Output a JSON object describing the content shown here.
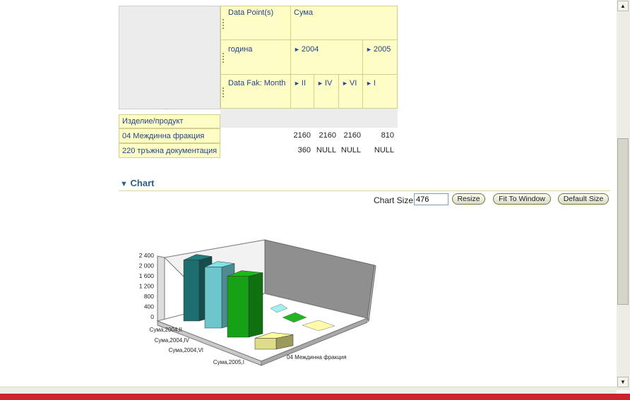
{
  "pivot": {
    "header_rows": [
      {
        "label": "Data Point(s)",
        "value": "Сума"
      },
      {
        "label": "година",
        "years": [
          "2004",
          "2005"
        ]
      },
      {
        "label": "Data Fak: Month",
        "months": [
          "II",
          "IV",
          "VI",
          "I"
        ]
      }
    ],
    "corner_grip": "...",
    "row_header_title": "Изделие/продукт",
    "rows": [
      {
        "label": "04 Междинна фракция",
        "values": [
          "2160",
          "2160",
          "2160",
          "810"
        ]
      },
      {
        "label": "220 тръжна документация",
        "values": [
          "360",
          "NULL",
          "NULL",
          "NULL"
        ]
      }
    ]
  },
  "chart_section": {
    "title": "Chart",
    "size_label": "Chart Size",
    "size_value": "476",
    "buttons": {
      "resize": "Resize",
      "fit": "Fit To Window",
      "default": "Default Size"
    }
  },
  "chart_data": {
    "type": "bar",
    "y_ticks": [
      "2 400",
      "2 000",
      "1 600",
      "1 200",
      "800",
      "400",
      "0"
    ],
    "ylim": [
      0,
      2400
    ],
    "x_category": "04 Междинна фракция",
    "series": [
      {
        "name": "Сума,2004,II",
        "values": [
          2160
        ],
        "color": "#1d6e6e"
      },
      {
        "name": "Сума,2004,IV",
        "values": [
          2160
        ],
        "color": "#6cc6cc"
      },
      {
        "name": "Сума,2004,VI",
        "values": [
          2160
        ],
        "color": "#16a216"
      },
      {
        "name": "Сума,2005,I",
        "values": [
          810
        ],
        "color": "#dedc86"
      }
    ],
    "back_series_colors": [
      "#9ff0f0",
      "#22b422",
      "#fffbaa"
    ]
  }
}
